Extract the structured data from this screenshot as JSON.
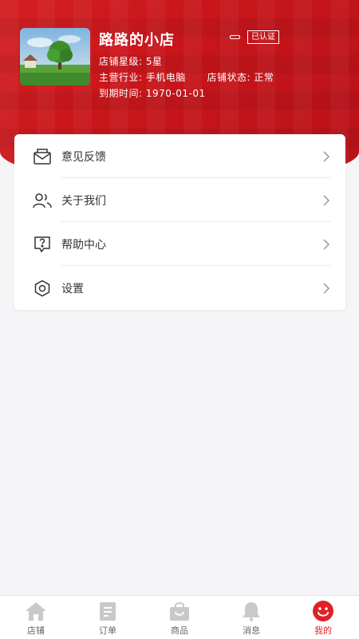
{
  "shop": {
    "name": "路路的小店",
    "verified_badge": "已认证",
    "star_label": "店铺星级:",
    "star_value": "5星",
    "industry_label": "主营行业:",
    "industry_value": "手机电脑",
    "status_label": "店铺状态:",
    "status_value": "正常",
    "expire_label": "到期时间:",
    "expire_value": "1970-01-01"
  },
  "menu": [
    {
      "label": "意见反馈",
      "icon": "mail-icon"
    },
    {
      "label": "关于我们",
      "icon": "users-icon"
    },
    {
      "label": "帮助中心",
      "icon": "help-icon"
    },
    {
      "label": "设置",
      "icon": "settings-icon"
    }
  ],
  "tabs": [
    {
      "label": "店铺",
      "icon": "home-icon",
      "active": false
    },
    {
      "label": "订单",
      "icon": "clipboard-icon",
      "active": false
    },
    {
      "label": "商品",
      "icon": "bag-icon",
      "active": false
    },
    {
      "label": "消息",
      "icon": "bell-icon",
      "active": false
    },
    {
      "label": "我的",
      "icon": "smiley-icon",
      "active": true
    }
  ],
  "colors": {
    "brand_red": "#d41f22",
    "active_tab": "#e02226",
    "inactive_icon": "#c9c9c9"
  }
}
